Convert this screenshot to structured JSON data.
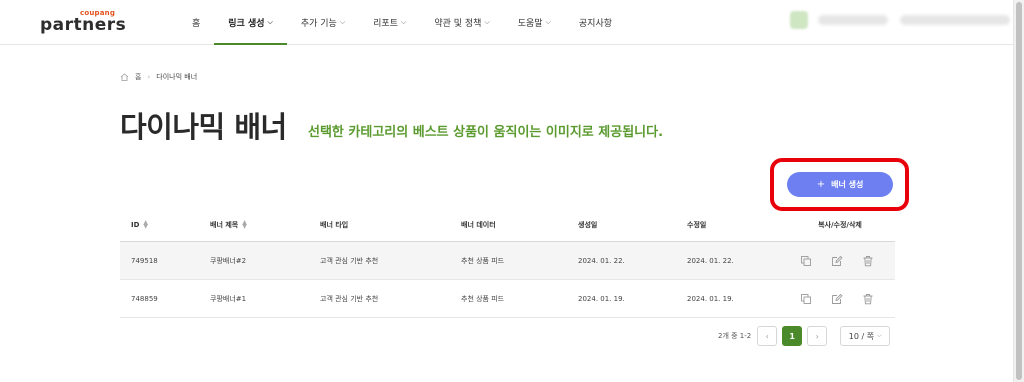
{
  "header": {
    "logo_small": "coupang",
    "logo_main": "partners",
    "nav": [
      {
        "label": "홈",
        "dropdown": false,
        "active": false
      },
      {
        "label": "링크 생성",
        "dropdown": true,
        "active": true
      },
      {
        "label": "추가 기능",
        "dropdown": true,
        "active": false
      },
      {
        "label": "리포트",
        "dropdown": true,
        "active": false
      },
      {
        "label": "약관 및 정책",
        "dropdown": true,
        "active": false
      },
      {
        "label": "도움말",
        "dropdown": true,
        "active": false
      },
      {
        "label": "공지사항",
        "dropdown": false,
        "active": false
      }
    ]
  },
  "breadcrumb": {
    "home": "홈",
    "current": "다이나믹 배너"
  },
  "page": {
    "title": "다이나믹 배너",
    "description": "선택한 카테고리의 베스트 상품이 움직이는 이미지로 제공됩니다.",
    "create_button": "배너 생성"
  },
  "table": {
    "headers": {
      "id": "ID",
      "title": "배너 제목",
      "type": "배너 타입",
      "data": "배너 데이터",
      "created": "생성일",
      "modified": "수정일",
      "actions": "복사/수정/삭제"
    },
    "rows": [
      {
        "id": "749518",
        "title": "쿠팡배너#2",
        "type": "고객 관심 기반 추천",
        "data": "추천 상품 피드",
        "created": "2024. 01. 22.",
        "modified": "2024. 01. 22."
      },
      {
        "id": "748859",
        "title": "쿠팡배너#1",
        "type": "고객 관심 기반 추천",
        "data": "추천 상품 피드",
        "created": "2024. 01. 19.",
        "modified": "2024. 01. 19."
      }
    ]
  },
  "pagination": {
    "count_text": "2개 중 1-2",
    "prev": "‹",
    "current_page": "1",
    "next": "›",
    "per_page": "10 / 쪽"
  },
  "colors": {
    "accent_green": "#4a8a2a",
    "desc_green": "#5a9a2e",
    "button_blue": "#6e7ff2",
    "highlight_red": "#e8000b"
  }
}
